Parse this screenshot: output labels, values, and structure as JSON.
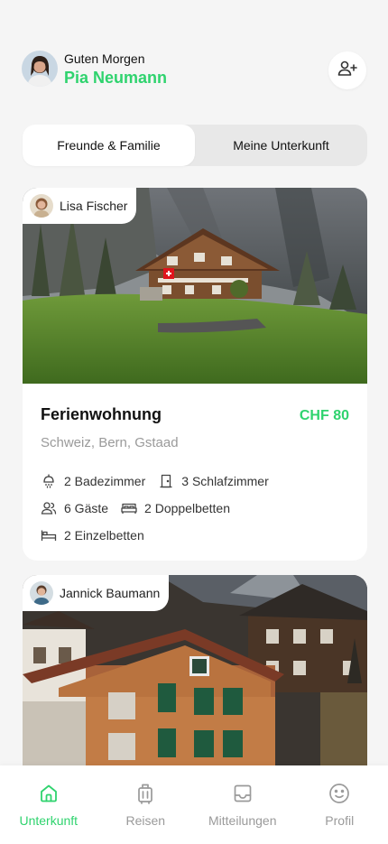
{
  "header": {
    "greeting": "Guten Morgen",
    "user_name": "Pia Neumann",
    "add_friend_icon": "user-plus-icon"
  },
  "segmented": {
    "tabs": [
      {
        "label": "Freunde & Familie",
        "active": true
      },
      {
        "label": "Meine Unterkunft",
        "active": false
      }
    ]
  },
  "listings": [
    {
      "owner": "Lisa Fischer",
      "title": "Ferienwohnung",
      "price": "CHF 80",
      "location": "Schweiz, Bern, Gstaad",
      "facts": {
        "bathrooms": "2 Badezimmer",
        "bedrooms": "3 Schlafzimmer",
        "guests": "6 Gäste",
        "double_beds": "2 Doppelbetten",
        "single_beds": "2 Einzelbetten"
      }
    },
    {
      "owner": "Jannick Baumann"
    }
  ],
  "tabbar": {
    "items": [
      {
        "label": "Unterkunft",
        "icon": "home-icon",
        "active": true
      },
      {
        "label": "Reisen",
        "icon": "luggage-icon",
        "active": false
      },
      {
        "label": "Mitteilungen",
        "icon": "inbox-icon",
        "active": false
      },
      {
        "label": "Profil",
        "icon": "smiley-icon",
        "active": false
      }
    ]
  },
  "colors": {
    "accent": "#2fd36e",
    "background": "#f5f5f5",
    "muted_text": "#9a9a9a"
  }
}
